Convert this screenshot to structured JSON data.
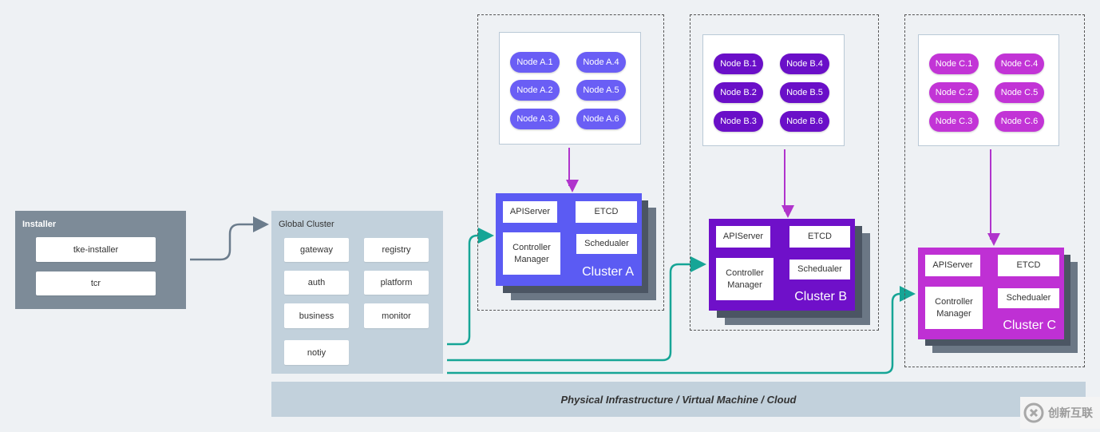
{
  "installer": {
    "title": "Installer",
    "items": [
      "tke-installer",
      "tcr"
    ]
  },
  "global_cluster": {
    "title": "Global Cluster",
    "items": [
      "gateway",
      "registry",
      "auth",
      "platform",
      "business",
      "monitor",
      "notiy"
    ]
  },
  "clusters": [
    {
      "name": "Cluster A",
      "color": "#5b5bf3",
      "node_color": "#6a5ef5",
      "nodes": [
        "Node A.1",
        "Node A.4",
        "Node A.2",
        "Node A.5",
        "Node A.3",
        "Node A.6"
      ],
      "components": {
        "apiserver": "APIServer",
        "etcd": "ETCD",
        "controller": "Controller Manager",
        "scheduler": "Schedualer"
      }
    },
    {
      "name": "Cluster B",
      "color": "#6f10c9",
      "node_color": "#6a0fc8",
      "nodes": [
        "Node B.1",
        "Node B.4",
        "Node B.2",
        "Node B.5",
        "Node B.3",
        "Node B.6"
      ],
      "components": {
        "apiserver": "APIServer",
        "etcd": "ETCD",
        "controller": "Controller Manager",
        "scheduler": "Schedualer"
      }
    },
    {
      "name": "Cluster C",
      "color": "#bf30d4",
      "node_color": "#c234d6",
      "nodes": [
        "Node C.1",
        "Node C.4",
        "Node C.2",
        "Node C.5",
        "Node C.3",
        "Node C.6"
      ],
      "components": {
        "apiserver": "APIServer",
        "etcd": "ETCD",
        "controller": "Controller Manager",
        "scheduler": "Schedualer"
      }
    }
  ],
  "infrastructure": "Physical Infrastructure / Virtual Machine / Cloud",
  "watermark": "创新互联",
  "colors": {
    "installer_bg": "#7d8b98",
    "global_bg": "#c2d1dc",
    "teal_arrow": "#16a596",
    "purple_arrow": "#b034cc",
    "gray_arrow": "#6b7c8c"
  }
}
